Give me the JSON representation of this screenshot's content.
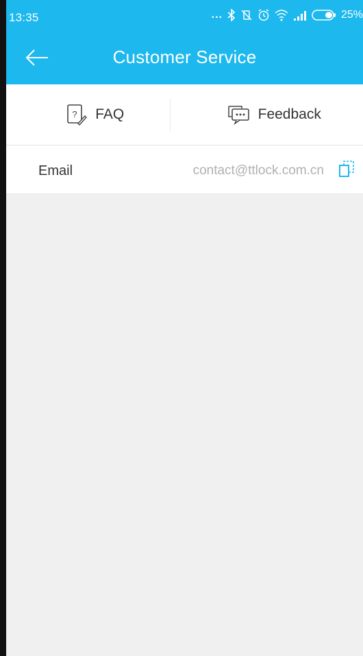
{
  "status_bar": {
    "time": "13:35",
    "dots": "...",
    "battery_percent": "25%"
  },
  "app_bar": {
    "title": "Customer Service",
    "back_icon": "arrow-left-icon"
  },
  "tabs": [
    {
      "label": "FAQ",
      "icon": "faq-question-icon"
    },
    {
      "label": "Feedback",
      "icon": "chat-bubble-icon"
    }
  ],
  "contact": {
    "label": "Email",
    "value": "contact@ttlock.com.cn",
    "copy_icon": "copy-icon"
  },
  "colors": {
    "accent": "#1cb8ee",
    "background": "#f0f0f0",
    "text_primary": "#333333",
    "text_secondary": "#b0b0b0"
  }
}
